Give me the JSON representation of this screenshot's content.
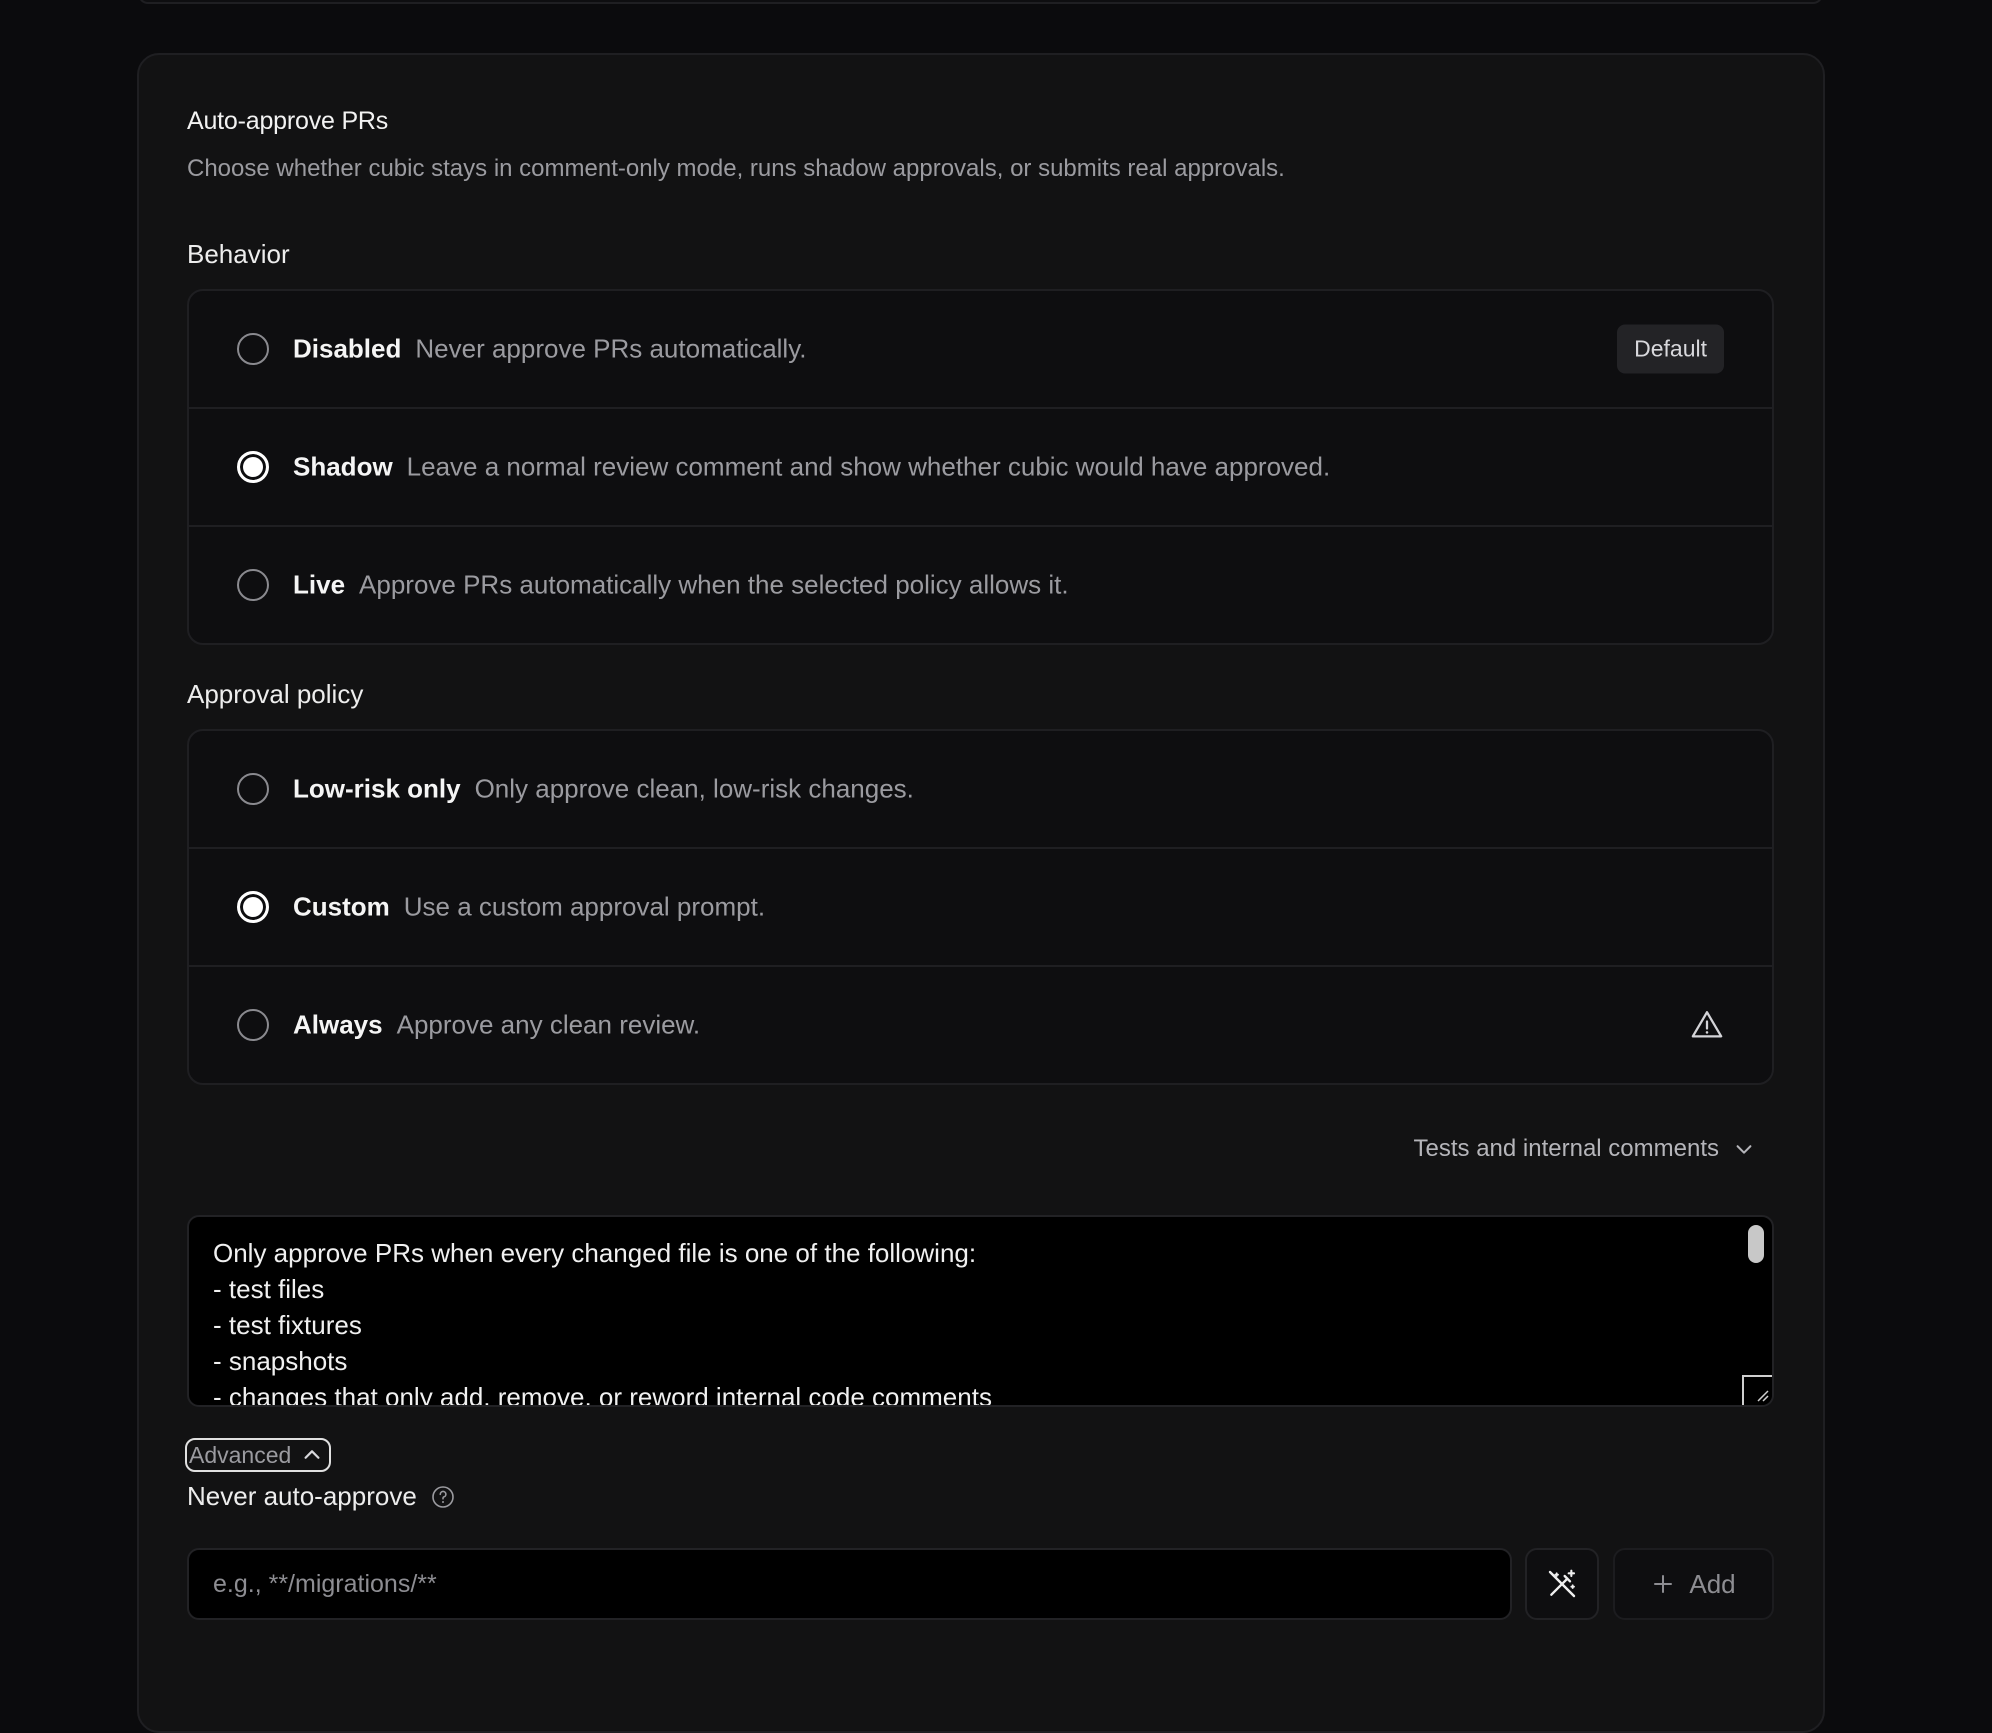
{
  "auto_approve": {
    "title": "Auto-approve PRs",
    "description": "Choose whether cubic stays in comment-only mode, runs shadow approvals, or submits real approvals."
  },
  "behavior": {
    "label": "Behavior",
    "options": [
      {
        "label": "Disabled",
        "description": "Never approve PRs automatically.",
        "badge": "Default",
        "selected": false
      },
      {
        "label": "Shadow",
        "description": "Leave a normal review comment and show whether cubic would have approved.",
        "selected": true
      },
      {
        "label": "Live",
        "description": "Approve PRs automatically when the selected policy allows it.",
        "selected": false
      }
    ]
  },
  "approval_policy": {
    "label": "Approval policy",
    "options": [
      {
        "label": "Low-risk only",
        "description": "Only approve clean, low-risk changes.",
        "selected": false
      },
      {
        "label": "Custom",
        "description": "Use a custom approval prompt.",
        "selected": true
      },
      {
        "label": "Always",
        "description": "Approve any clean review.",
        "selected": false,
        "icon": "warning-triangle-icon"
      }
    ],
    "preset_label": "Tests and internal comments",
    "prompt": "Only approve PRs when every changed file is one of the following:\n- test files\n- test fixtures\n- snapshots\n- changes that only add, remove, or reword internal code comments"
  },
  "advanced": {
    "toggle_label": "Advanced",
    "never_label": "Never auto-approve",
    "input_placeholder": "e.g., **/migrations/**",
    "add_label": "Add"
  },
  "colors": {
    "background": "#0b0b0d",
    "card": "#121213",
    "border": "#1f1f22",
    "text": "#ededed",
    "muted": "#9b9ba0"
  }
}
